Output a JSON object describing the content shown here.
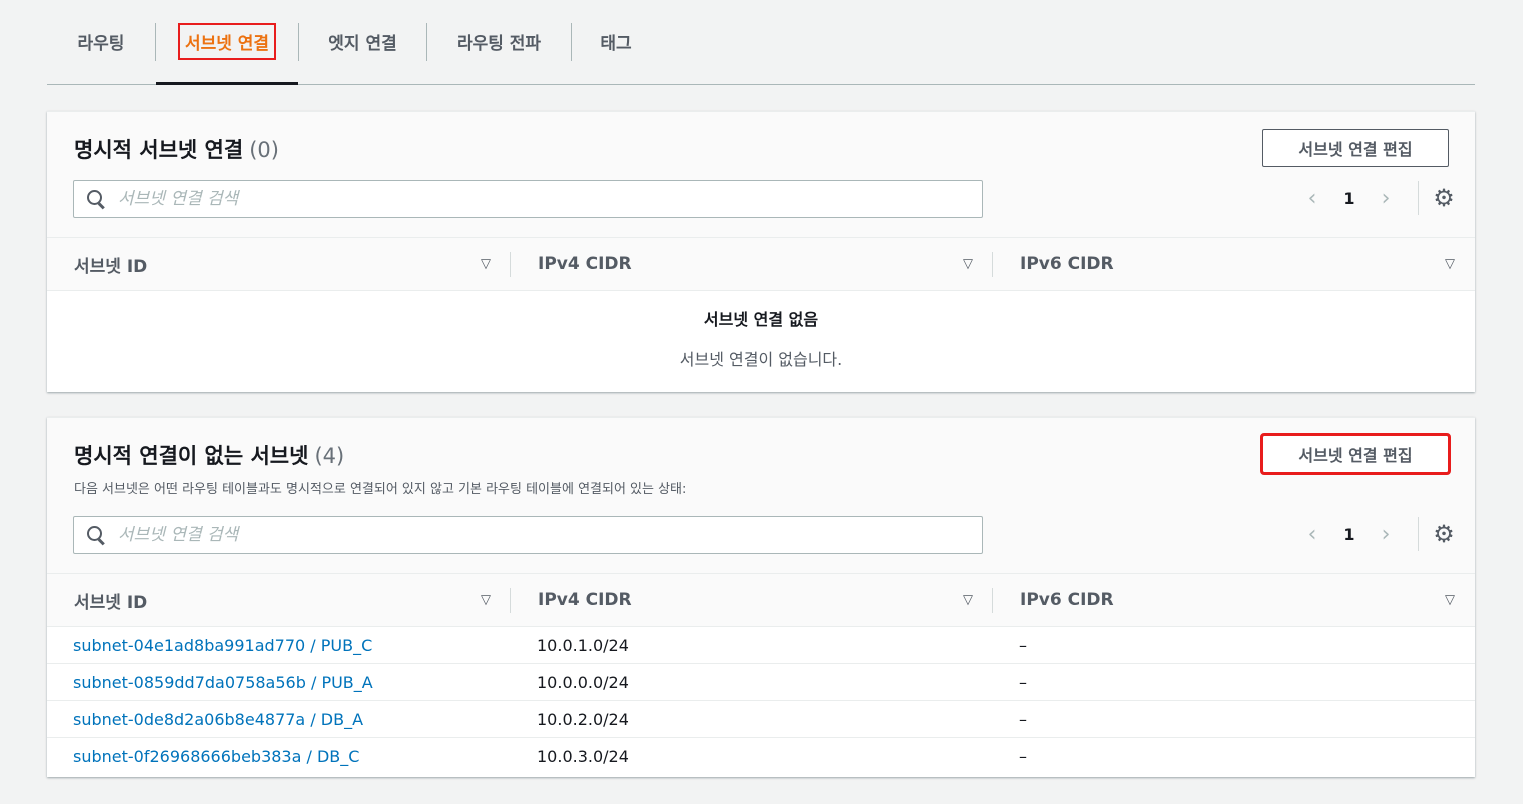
{
  "tabs": [
    {
      "label": "라우팅",
      "active": false
    },
    {
      "label": "서브넷 연결",
      "active": true
    },
    {
      "label": "엣지 연결",
      "active": false
    },
    {
      "label": "라우팅 전파",
      "active": false
    },
    {
      "label": "태그",
      "active": false
    }
  ],
  "explicit": {
    "title": "명시적 서브넷 연결",
    "count": "(0)",
    "edit_label": "서브넷 연결 편집",
    "search_placeholder": "서브넷 연결 검색",
    "page": "1",
    "columns": [
      "서브넷 ID",
      "IPv4 CIDR",
      "IPv6 CIDR"
    ],
    "empty_title": "서브넷 연결 없음",
    "empty_desc": "서브넷 연결이 없습니다."
  },
  "implicit": {
    "title": "명시적 연결이 없는 서브넷",
    "count": "(4)",
    "description": "다음 서브넷은 어떤 라우팅 테이블과도 명시적으로 연결되어 있지 않고 기본 라우팅 테이블에 연결되어 있는 상태:",
    "edit_label": "서브넷 연결 편집",
    "search_placeholder": "서브넷 연결 검색",
    "page": "1",
    "columns": [
      "서브넷 ID",
      "IPv4 CIDR",
      "IPv6 CIDR"
    ],
    "rows": [
      {
        "subnet": "subnet-04e1ad8ba991ad770 / PUB_C",
        "ipv4": "10.0.1.0/24",
        "ipv6": "–"
      },
      {
        "subnet": "subnet-0859dd7da0758a56b / PUB_A",
        "ipv4": "10.0.0.0/24",
        "ipv6": "–"
      },
      {
        "subnet": "subnet-0de8d2a06b8e4877a / DB_A",
        "ipv4": "10.0.2.0/24",
        "ipv6": "–"
      },
      {
        "subnet": "subnet-0f26968666beb383a / DB_C",
        "ipv4": "10.0.3.0/24",
        "ipv6": "–"
      }
    ]
  },
  "icons": {
    "prev": "chevron-left-icon",
    "next": "chevron-right-icon",
    "settings": "gear-icon",
    "sort": "caret-down-icon",
    "search": "search-icon"
  },
  "colors": {
    "accent": "#ec7211",
    "link": "#0073bb",
    "highlight": "#e81c1c"
  }
}
